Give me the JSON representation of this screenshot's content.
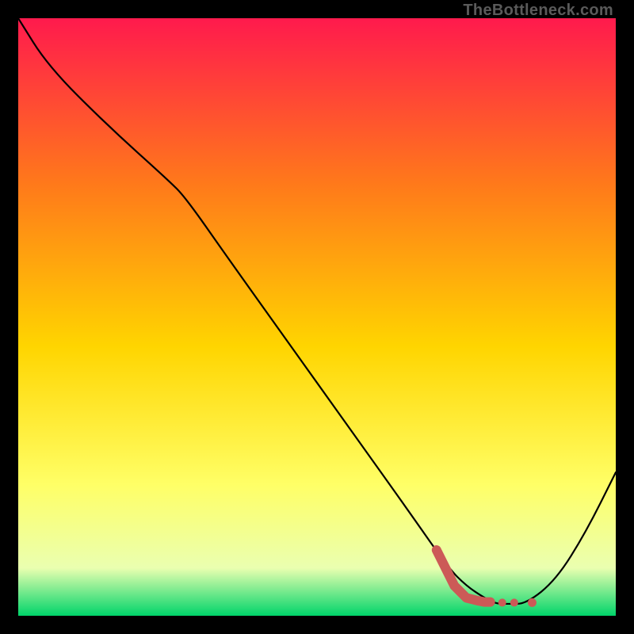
{
  "watermark": "TheBottleneck.com",
  "colors": {
    "frame": "#000000",
    "gradient_top": "#ff1a4d",
    "gradient_upper_mid": "#ff7a1a",
    "gradient_mid": "#ffd500",
    "gradient_lower_mid": "#ffff66",
    "gradient_lower": "#eaffb0",
    "gradient_bottom": "#00d46a",
    "curve": "#000000",
    "worm": "#cc5a57",
    "worm_highlight": "#e98b88"
  },
  "chart_data": {
    "type": "line",
    "title": "",
    "xlabel": "",
    "ylabel": "",
    "xlim": [
      0,
      100
    ],
    "ylim": [
      0,
      100
    ],
    "grid": false,
    "legend": false,
    "series": [
      {
        "name": "bottleneck-curve",
        "x": [
          0,
          5,
          15,
          25,
          28,
          35,
          45,
          55,
          65,
          72,
          75,
          78,
          80,
          82,
          85,
          90,
          95,
          100
        ],
        "y": [
          100,
          92,
          82,
          73,
          70,
          60,
          46,
          32,
          18,
          8,
          5,
          3,
          2,
          2,
          2,
          6,
          14,
          24
        ]
      }
    ],
    "annotations": [
      {
        "name": "worm-segment-main",
        "type": "thick-line",
        "x": [
          70,
          73,
          75,
          77,
          78,
          79
        ],
        "y": [
          11,
          5,
          3,
          2.5,
          2.3,
          2.3
        ]
      },
      {
        "name": "worm-dot-1",
        "type": "dot",
        "x": 81,
        "y": 2.2
      },
      {
        "name": "worm-dot-2",
        "type": "dot",
        "x": 83,
        "y": 2.2
      },
      {
        "name": "worm-dot-3",
        "type": "dot",
        "x": 86,
        "y": 2.2
      }
    ]
  }
}
